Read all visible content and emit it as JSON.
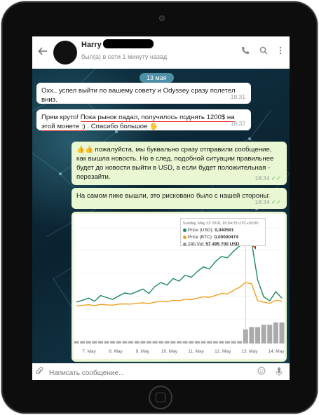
{
  "header": {
    "contact_name": "Harry",
    "last_seen": "был(а) в сети 1 минуту назад",
    "icons": [
      "back-arrow-icon",
      "phone-icon",
      "search-icon",
      "more-vertical-icon"
    ]
  },
  "chat": {
    "date_badge": "13 мая",
    "messages": [
      {
        "dir": "in",
        "text": "Охх.. успел выйти по вашему совету и Odyssey сразу полетел вниз.",
        "time": "18:31"
      },
      {
        "dir": "in",
        "text_pre": "Прям круто! ",
        "text_underlined": "Пока рынок падал, получилось поднять 1200$ на этой монете :)",
        "text_post": " . Спасибо большое 🖐",
        "time": "18:32"
      },
      {
        "dir": "out",
        "text": "👍👍 пожалуйста, мы буквально сразу отправили сообщение, как вышла новость. Но в след. подобной ситуации правильнее будет до новости выйти в USD, а если будет положительная - перезайти.",
        "time": "18:34"
      },
      {
        "dir": "out",
        "text": "На самом пике вышли, это рисковано было с нашей стороны:",
        "time": "18:34"
      }
    ]
  },
  "chart_tooltip": {
    "datetime": "Sunday, May 13 2018, 16:54:23 UTC+03:00",
    "price_usd_label": "Price (USD):",
    "price_usd_value": "0,040591",
    "price_btc_label": "Price (BTC):",
    "price_btc_value": "0,00000474",
    "vol_label": "24h Vol:",
    "vol_value": "57 495 700 USD"
  },
  "chart_data": {
    "type": "line",
    "x_tick_labels": [
      "7. May",
      "8. May",
      "9. May",
      "10. May",
      "11. May",
      "12. May",
      "13. May",
      "14. May"
    ],
    "series": [
      {
        "name": "Price (USD)",
        "color": "#1a8a5a",
        "values": [
          0.0165,
          0.0172,
          0.018,
          0.0168,
          0.019,
          0.0182,
          0.0175,
          0.0188,
          0.02,
          0.0195,
          0.0205,
          0.0215,
          0.0198,
          0.0225,
          0.024,
          0.023,
          0.0255,
          0.0245,
          0.0268,
          0.026,
          0.0282,
          0.03,
          0.0292,
          0.032,
          0.034,
          0.0335,
          0.036,
          0.038,
          0.0406,
          0.0395,
          0.025,
          0.0185,
          0.017,
          0.0205,
          0.018
        ]
      },
      {
        "name": "Price (BTC)",
        "color": "#f0a020",
        "values": [
          0.015,
          0.0152,
          0.0155,
          0.0151,
          0.0156,
          0.0154,
          0.0153,
          0.0157,
          0.0158,
          0.0157,
          0.016,
          0.0162,
          0.0159,
          0.0165,
          0.0168,
          0.0166,
          0.0172,
          0.017,
          0.0176,
          0.0174,
          0.018,
          0.0185,
          0.0183,
          0.019,
          0.0198,
          0.0196,
          0.021,
          0.0222,
          0.024,
          0.0235,
          0.017,
          0.0165,
          0.016,
          0.0172,
          0.0168
        ]
      },
      {
        "name": "24h Vol",
        "color": "#999999",
        "values": [
          1,
          1,
          1,
          1,
          1,
          1,
          1,
          1,
          1,
          1,
          1,
          1,
          1,
          1,
          1,
          1,
          1,
          1,
          1,
          1,
          1,
          1,
          1,
          1,
          1,
          1,
          1,
          1,
          6,
          7,
          7,
          8,
          8,
          9,
          9
        ]
      }
    ],
    "ylim": [
      0.01,
      0.045
    ],
    "annotation": "red arrow pointing at peak"
  },
  "input": {
    "placeholder": "Написать сообщение..."
  },
  "colors": {
    "accent_green": "#5cb85c",
    "red_underline": "#e0201e",
    "date_badge": "#4d8fa6"
  }
}
